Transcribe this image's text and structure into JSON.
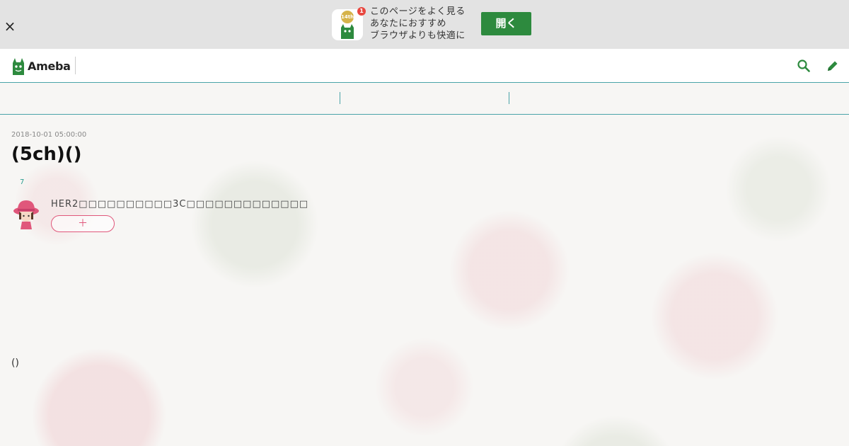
{
  "banner": {
    "close_label": "×",
    "app_icon_years": "14th",
    "notification_count": "1",
    "text_lines": [
      "このページをよく見る",
      "あなたにおすすめ",
      "ブラウザよりも快適に"
    ],
    "open_label": "開く"
  },
  "header": {
    "logo_text": "Ameba",
    "brand_color": "#2d8a3e",
    "icons": [
      "search-icon",
      "pencil-icon"
    ]
  },
  "post": {
    "date": "2018-10-01 05:00:00",
    "title": "(5ch)()",
    "like_count": "7",
    "profile_text": "HER2\u0000\u0000\u0000\u0000\u0000\u0000\u0000\u0000\u0000\u00003C\u0000\u0000\u0000\u0000\u0000\u0000\u0000\u0000\u0000\u0000\u0000\u0000\u0000",
    "follow_label": "＋",
    "body": "()"
  },
  "colors": {
    "accent_teal": "#4aa3a8",
    "follow_pink": "#e0577b",
    "open_button_green": "#2d8a3e"
  }
}
